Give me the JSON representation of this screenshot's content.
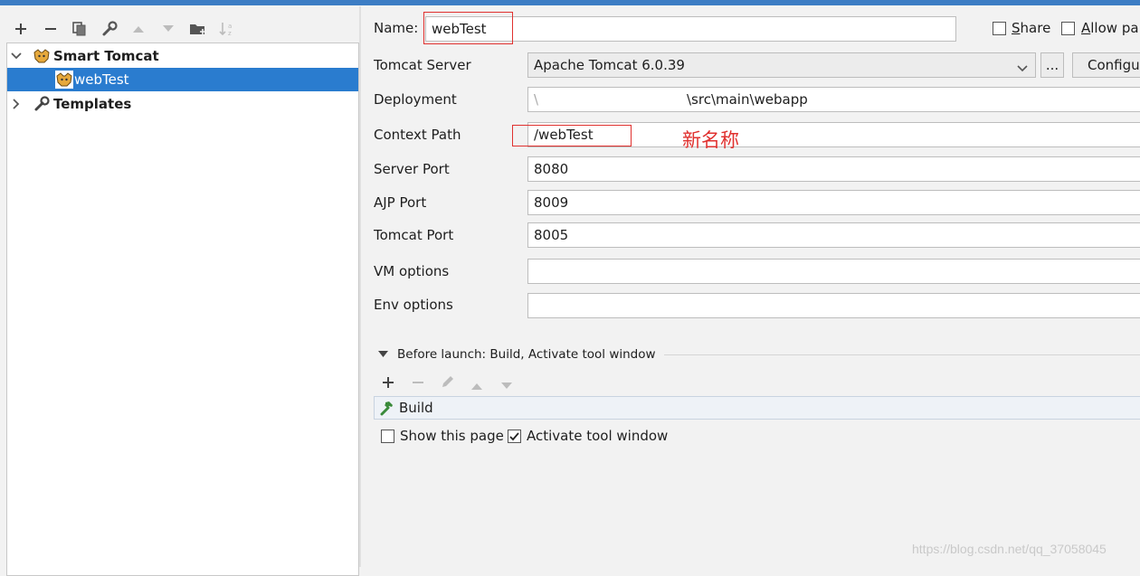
{
  "left": {
    "tree": {
      "group_label": "Smart Tomcat",
      "config_label": "webTest",
      "templates_label": "Templates"
    }
  },
  "form": {
    "name_label": "Name:",
    "name_value": "webTest",
    "share_label": "Share",
    "allow_label": "Allow pa",
    "server_label": "Tomcat Server",
    "server_value": "Apache Tomcat 6.0.39",
    "ellipsis_label": "...",
    "configure_label": "Configu",
    "deployment_label": "Deployment",
    "deployment_value": "\\src\\main\\webapp",
    "context_label": "Context Path",
    "context_value": "/webTest",
    "server_port_label": "Server Port",
    "server_port_value": "8080",
    "ajp_label": "AJP Port",
    "ajp_value": "8009",
    "tomcat_port_label": "Tomcat Port",
    "tomcat_port_value": "8005",
    "vm_label": "VM options",
    "vm_value": "",
    "env_label": "Env options",
    "env_value": ""
  },
  "annotation": "新名称",
  "before_launch": {
    "header": "Before launch: Build, Activate tool window",
    "task": "Build",
    "show_page_label": "Show this page",
    "show_page_checked": false,
    "activate_label": "Activate tool window",
    "activate_checked": true
  },
  "watermark": "https://blog.csdn.net/qq_37058045",
  "colors": {
    "accent": "#2a7ccf",
    "annotation_red": "#e0312f"
  }
}
